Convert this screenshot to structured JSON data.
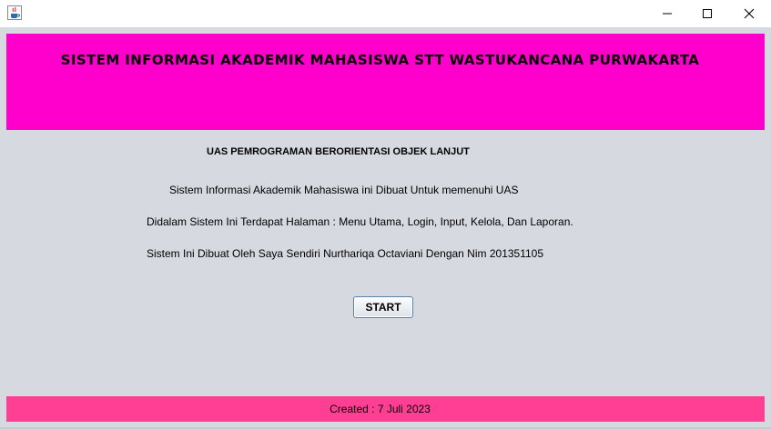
{
  "window": {
    "minimize_glyph": "—",
    "maximize_glyph": "☐",
    "close_glyph": "✕",
    "icons": [
      "java-cup-icon",
      "minimize-icon",
      "maximize-icon",
      "close-icon"
    ]
  },
  "header": {
    "title": "SISTEM INFORMASI AKADEMIK MAHASISWA STT WASTUKANCANA PURWAKARTA",
    "background": "#ff00cc"
  },
  "main": {
    "subtitle": "UAS PEMROGRAMAN BERORIENTASI OBJEK LANJUT",
    "lines": [
      "Sistem Informasi Akademik Mahasiswa ini Dibuat Untuk memenuhi UAS",
      "Didalam Sistem Ini Terdapat Halaman : Menu Utama, Login, Input, Kelola, Dan Laporan.",
      "Sistem Ini Dibuat Oleh Saya Sendiri Nurthariqa Octaviani Dengan Nim 201351105"
    ],
    "start_label": "START"
  },
  "footer": {
    "text": "Created : 7 Juli 2023",
    "background": "#ff3f94"
  }
}
